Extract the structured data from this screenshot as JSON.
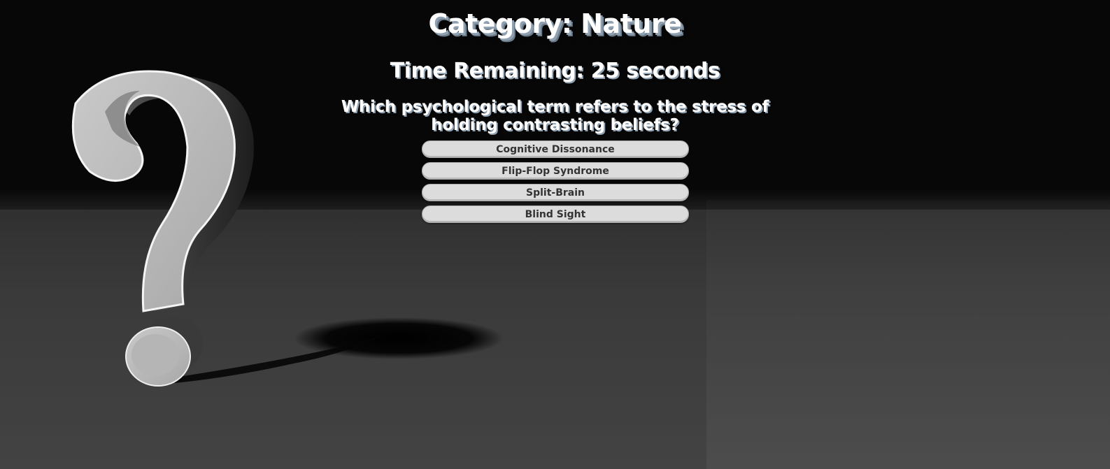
{
  "game": {
    "category_heading": "Category: Nature",
    "timer_text": "Time Remaining: 25 seconds",
    "question": "Which psychological term refers to the stress of holding contrasting beliefs?",
    "answers": [
      "Cognitive Dissonance",
      "Flip-Flop Syndrome",
      "Split-Brain",
      "Blind Sight"
    ]
  },
  "background": {
    "icon": "question-mark-icon",
    "colors": {
      "sky": "#070707",
      "floor": "#434343",
      "button": "#dcdcdc",
      "button_text": "#333333",
      "text": "#ffffff",
      "text_shadow": "#8fa0b0"
    }
  }
}
